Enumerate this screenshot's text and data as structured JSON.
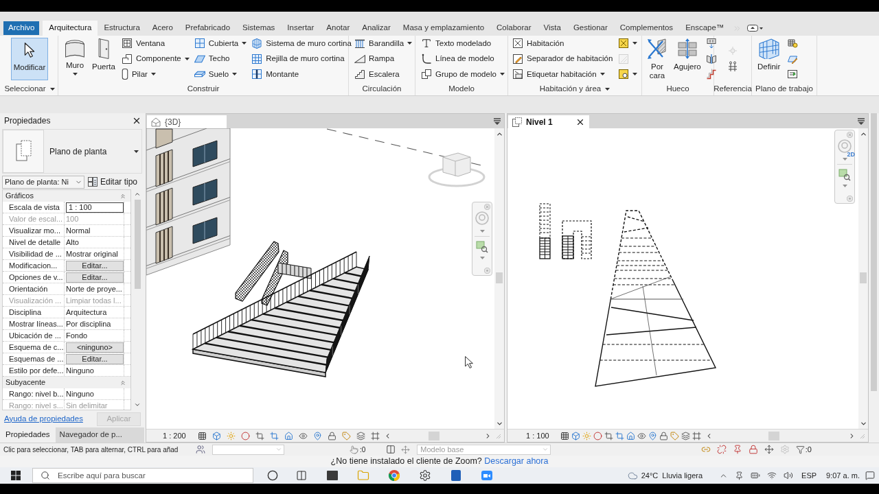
{
  "ribbon_tabs": [
    {
      "label": "Archivo",
      "kind": "file",
      "selected": false
    },
    {
      "label": "Arquitectura",
      "kind": "tab",
      "selected": true
    },
    {
      "label": "Estructura",
      "kind": "tab",
      "selected": false
    },
    {
      "label": "Acero",
      "kind": "tab",
      "selected": false
    },
    {
      "label": "Prefabricado",
      "kind": "tab",
      "selected": false
    },
    {
      "label": "Sistemas",
      "kind": "tab",
      "selected": false
    },
    {
      "label": "Insertar",
      "kind": "tab",
      "selected": false
    },
    {
      "label": "Anotar",
      "kind": "tab",
      "selected": false
    },
    {
      "label": "Analizar",
      "kind": "tab",
      "selected": false
    },
    {
      "label": "Masa y emplazamiento",
      "kind": "tab",
      "selected": false
    },
    {
      "label": "Colaborar",
      "kind": "tab",
      "selected": false
    },
    {
      "label": "Vista",
      "kind": "tab",
      "selected": false
    },
    {
      "label": "Gestionar",
      "kind": "tab",
      "selected": false
    },
    {
      "label": "Complementos",
      "kind": "tab",
      "selected": false
    },
    {
      "label": "Enscape™",
      "kind": "tab",
      "selected": false
    }
  ],
  "ribbon": {
    "groups": [
      {
        "title": "Seleccionar",
        "menu": true,
        "columns": [
          [
            {
              "kind": "large",
              "label": "Modificar",
              "selected": true,
              "dropdown": false
            }
          ]
        ]
      },
      {
        "title": "Construir",
        "menu": false,
        "columns": [
          [
            {
              "kind": "large",
              "label": "Muro",
              "selected": false,
              "dropdown": true
            }
          ],
          [
            {
              "kind": "large",
              "label": "Puerta",
              "selected": false,
              "dropdown": false
            }
          ],
          [
            {
              "kind": "small",
              "label": "Ventana",
              "dropdown": false
            },
            {
              "kind": "small",
              "label": "Componente",
              "dropdown": true
            },
            {
              "kind": "small",
              "label": "Pilar",
              "dropdown": true
            }
          ],
          [
            {
              "kind": "small",
              "label": "Cubierta",
              "dropdown": true
            },
            {
              "kind": "small",
              "label": "Techo",
              "dropdown": false
            },
            {
              "kind": "small",
              "label": "Suelo",
              "dropdown": true
            }
          ],
          [
            {
              "kind": "small",
              "label": "Sistema de muro cortina",
              "dropdown": false
            },
            {
              "kind": "small",
              "label": "Rejilla de muro cortina",
              "dropdown": false
            },
            {
              "kind": "small",
              "label": "Montante",
              "dropdown": false
            }
          ]
        ]
      },
      {
        "title": "Circulación",
        "menu": false,
        "columns": [
          [
            {
              "kind": "small",
              "label": "Barandilla",
              "dropdown": true
            },
            {
              "kind": "small",
              "label": "Rampa",
              "dropdown": false
            },
            {
              "kind": "small",
              "label": "Escalera",
              "dropdown": false
            }
          ]
        ]
      },
      {
        "title": "Modelo",
        "menu": false,
        "columns": [
          [
            {
              "kind": "small",
              "label": "Texto modelado",
              "dropdown": false
            },
            {
              "kind": "small",
              "label": "Línea de modelo",
              "dropdown": false
            },
            {
              "kind": "small",
              "label": "Grupo de modelo",
              "dropdown": true
            }
          ]
        ]
      },
      {
        "title": "Habitación y área",
        "menu": true,
        "columns": [
          [
            {
              "kind": "small",
              "label": "Habitación",
              "dropdown": false
            },
            {
              "kind": "small",
              "label": "Separador de habitación",
              "dropdown": false
            },
            {
              "kind": "small",
              "label": "Etiquetar habitación",
              "dropdown": true
            }
          ],
          [
            {
              "kind": "icon",
              "dropdown": true,
              "disabled": false
            },
            {
              "kind": "icon",
              "dropdown": false,
              "disabled": true
            },
            {
              "kind": "icon",
              "dropdown": true,
              "disabled": false
            }
          ]
        ]
      },
      {
        "title": "Hueco",
        "menu": false,
        "columns": [
          [
            {
              "kind": "large",
              "label": "Por cara",
              "selected": false,
              "dropdown": false
            }
          ],
          [
            {
              "kind": "large",
              "label": "Agujero",
              "selected": false,
              "dropdown": false
            }
          ],
          [
            {
              "kind": "icon",
              "dropdown": false,
              "disabled": false
            },
            {
              "kind": "icon",
              "dropdown": false,
              "disabled": false
            },
            {
              "kind": "icon",
              "dropdown": false,
              "disabled": false
            }
          ]
        ]
      },
      {
        "title": "Referencia",
        "menu": false,
        "columns": [
          [
            {
              "kind": "icon",
              "dropdown": false,
              "disabled": true
            },
            {
              "kind": "icon",
              "dropdown": false,
              "disabled": false
            }
          ]
        ]
      },
      {
        "title": "Plano de trabajo",
        "menu": false,
        "columns": [
          [
            {
              "kind": "large",
              "label": "Definir",
              "selected": false,
              "dropdown": false
            }
          ],
          [
            {
              "kind": "icon",
              "dropdown": false,
              "disabled": false
            },
            {
              "kind": "icon",
              "dropdown": false,
              "disabled": false
            },
            {
              "kind": "icon",
              "dropdown": false,
              "disabled": false
            }
          ]
        ]
      }
    ]
  },
  "properties": {
    "title": "Propiedades",
    "type_name": "Plano de planta",
    "view_type": "Plano de planta: Ni",
    "edit_type": "Editar tipo",
    "sections": [
      {
        "title": "Gráficos",
        "expanded": true,
        "rows": [
          {
            "name": "Escala de vista",
            "value": "1 : 100",
            "kind": "input",
            "disabled": false
          },
          {
            "name": "Valor de escal...",
            "value": "100",
            "kind": "text",
            "disabled": true
          },
          {
            "name": "Visualizar mo...",
            "value": "Normal",
            "kind": "text",
            "disabled": false
          },
          {
            "name": "Nivel de detalle",
            "value": "Alto",
            "kind": "text",
            "disabled": false
          },
          {
            "name": "Visibilidad de ...",
            "value": "Mostrar original",
            "kind": "text",
            "disabled": false
          },
          {
            "name": "Modificacion...",
            "value": "Editar...",
            "kind": "button",
            "disabled": false
          },
          {
            "name": "Opciones de v...",
            "value": "Editar...",
            "kind": "button",
            "disabled": false
          },
          {
            "name": "Orientación",
            "value": "Norte de proye...",
            "kind": "text",
            "disabled": false
          },
          {
            "name": "Visualización ...",
            "value": "Limpiar todas l...",
            "kind": "text",
            "disabled": true
          },
          {
            "name": "Disciplina",
            "value": "Arquitectura",
            "kind": "text",
            "disabled": false
          },
          {
            "name": "Mostrar líneas...",
            "value": "Por disciplina",
            "kind": "text",
            "disabled": false
          },
          {
            "name": "Ubicación de ...",
            "value": "Fondo",
            "kind": "text",
            "disabled": false
          },
          {
            "name": "Esquema de c...",
            "value": "<ninguno>",
            "kind": "button",
            "disabled": false
          },
          {
            "name": "Esquemas de ...",
            "value": "Editar...",
            "kind": "button",
            "disabled": false
          },
          {
            "name": "Estilo por defe...",
            "value": "Ninguno",
            "kind": "text",
            "disabled": false
          }
        ]
      },
      {
        "title": "Subyacente",
        "expanded": true,
        "rows": [
          {
            "name": "Rango: nivel b...",
            "value": "Ninguno",
            "kind": "text",
            "disabled": false
          },
          {
            "name": "Rango: nivel s...",
            "value": "Sin delimitar",
            "kind": "text",
            "disabled": true
          }
        ]
      }
    ],
    "help_link": "Ayuda de propiedades",
    "apply": {
      "label": "Aplicar",
      "disabled": true
    },
    "tabs": [
      {
        "label": "Propiedades",
        "selected": true
      },
      {
        "label": "Navegador de p...",
        "selected": false
      }
    ]
  },
  "views": [
    {
      "title": "{3D}",
      "kind": "perspective",
      "selected": false,
      "scale": "1 : 200"
    },
    {
      "title": "Nivel 1",
      "kind": "plan",
      "selected": true,
      "scale": "1 : 100",
      "wheel_label": "2D"
    }
  ],
  "status_bar": {
    "message": "Clic para seleccionar, TAB para alternar, CTRL para añad",
    "selection_count": ":0",
    "design_option": {
      "value": "Modelo base",
      "disabled": true
    },
    "filter_count": ":0"
  },
  "notice": {
    "text": "¿No tiene instalado el cliente de Zoom?",
    "link": "Descargar ahora"
  },
  "taskbar": {
    "search_placeholder": "Escribe aquí para buscar",
    "weather": "24°C  Lluvia ligera",
    "language": "ESP",
    "time": "9:07 a. m."
  }
}
